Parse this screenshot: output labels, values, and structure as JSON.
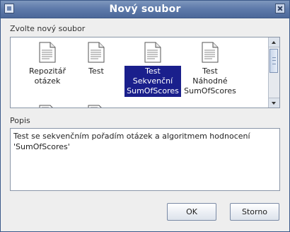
{
  "window": {
    "title": "Nový soubor"
  },
  "labels": {
    "choose": "Zvolte nový soubor",
    "description": "Popis"
  },
  "files": [
    {
      "caption": "Repozitář\notázek",
      "icon": "document-icon",
      "selected": false
    },
    {
      "caption": "Test",
      "icon": "document-icon",
      "selected": false
    },
    {
      "caption": "Test\nSekvenční\nSumOfScores",
      "icon": "document-icon",
      "selected": true
    },
    {
      "caption": "Test\nNáhodné\nSumOfScores",
      "icon": "document-icon",
      "selected": false
    }
  ],
  "description": {
    "text": "Test se sekvenčním pořadím otázek a algoritmem hodnocení 'SumOfScores'"
  },
  "buttons": {
    "ok": "OK",
    "cancel": "Storno"
  },
  "colors": {
    "titlebar": "#5f7bab",
    "selection": "#1a1f8c"
  }
}
